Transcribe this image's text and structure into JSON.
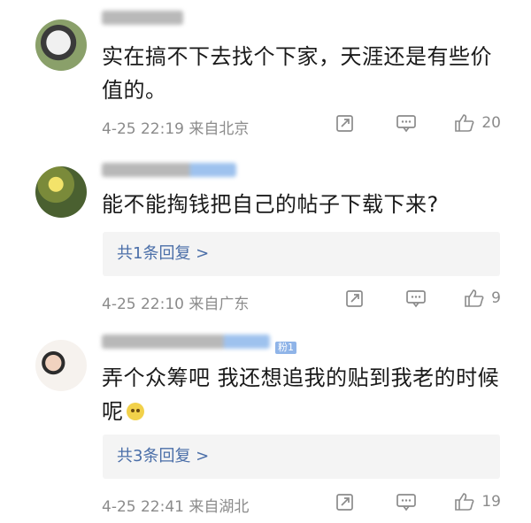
{
  "comments": [
    {
      "text": "实在搞不下去找个下家，天涯还是有些价值的。",
      "time": "4-25 22:19",
      "location": "来自北京",
      "likes": "20",
      "reply_label": ""
    },
    {
      "text": "能不能掏钱把自己的帖子下载下来?",
      "time": "4-25 22:10",
      "location": "来自广东",
      "likes": "9",
      "reply_label": "共1条回复 >"
    },
    {
      "text": "弄个众筹吧 我还想追我的贴到我老的时候呢",
      "time": "4-25 22:41",
      "location": "来自湖北",
      "likes": "19",
      "reply_label": "共3条回复 >",
      "fan_badge": "粉1"
    }
  ],
  "icons": [
    "repost-icon",
    "comment-icon",
    "like-icon"
  ]
}
